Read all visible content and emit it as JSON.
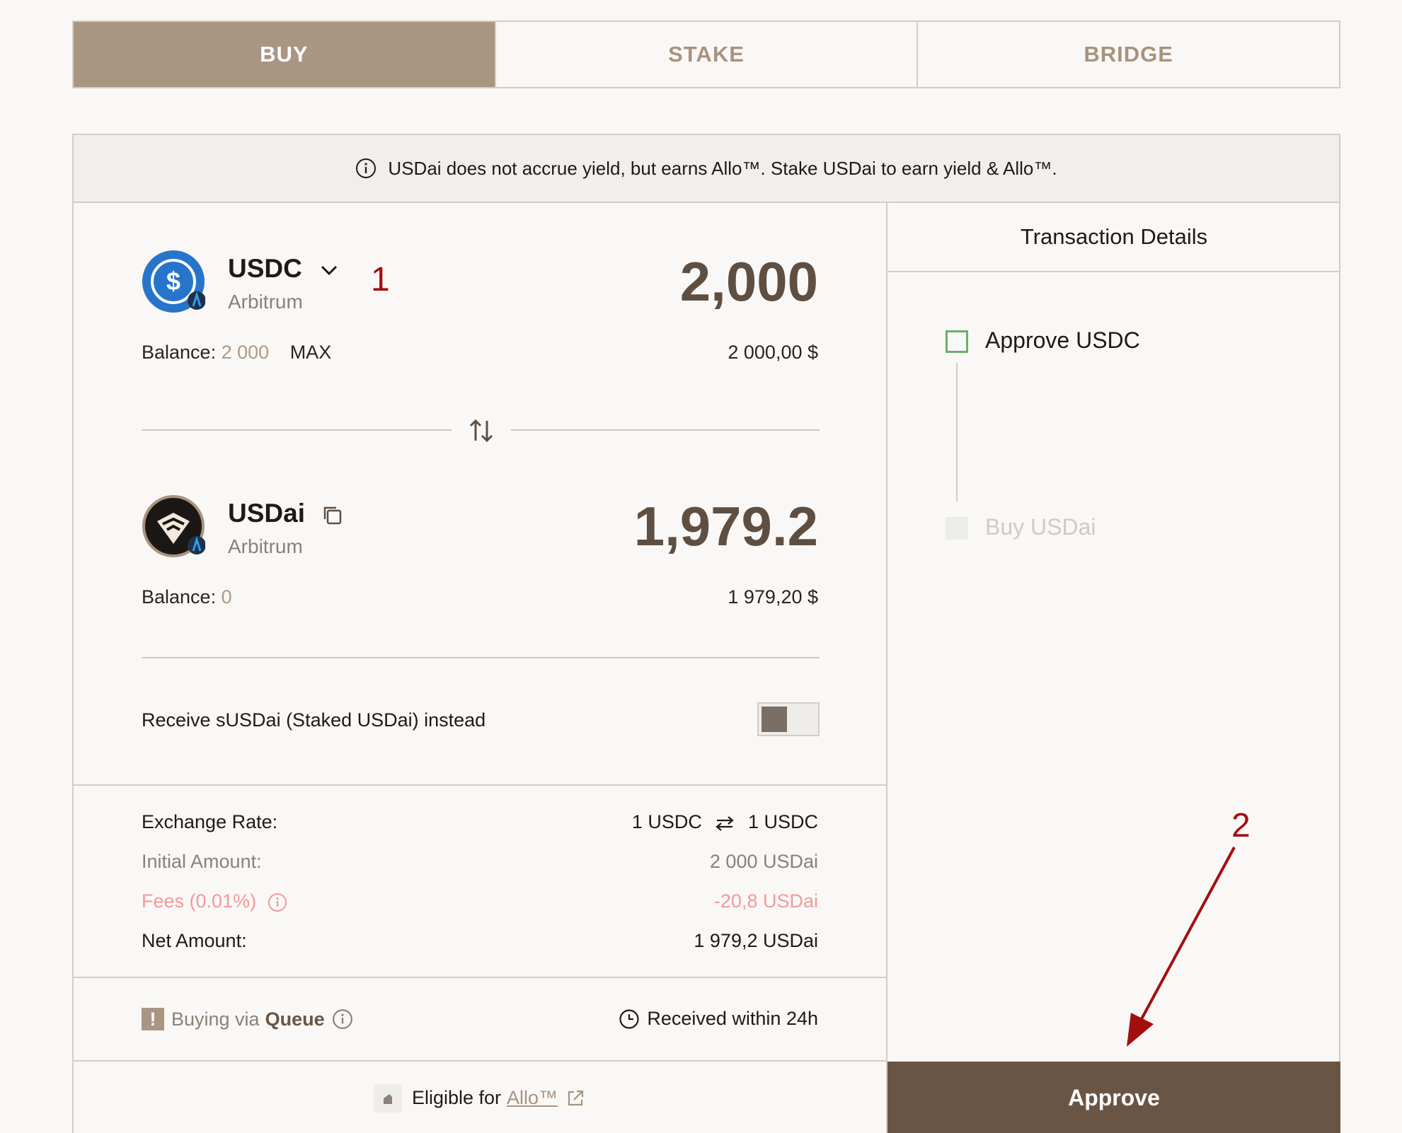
{
  "tabs": [
    {
      "label": "BUY",
      "active": true
    },
    {
      "label": "STAKE",
      "active": false
    },
    {
      "label": "BRIDGE",
      "active": false
    }
  ],
  "notice": "USDai does not accrue yield, but earns Allo™. Stake USDai to earn yield & Allo™.",
  "from": {
    "token": "USDC",
    "network": "Arbitrum",
    "amount": "2,000",
    "balance_label": "Balance:",
    "balance_value": "2 000",
    "max_label": "MAX",
    "usd_value": "2 000,00 $"
  },
  "to": {
    "token": "USDai",
    "network": "Arbitrum",
    "amount": "1,979.2",
    "balance_label": "Balance:",
    "balance_value": "0",
    "usd_value": "1 979,20 $"
  },
  "receive_toggle_label": "Receive sUSDai (Staked USDai) instead",
  "summary": {
    "exchange_rate_label": "Exchange Rate:",
    "exchange_rate_left": "1 USDC",
    "exchange_rate_right": "1 USDC",
    "initial_label": "Initial Amount:",
    "initial_value": "2 000 USDai",
    "fees_label": "Fees (0.01%)",
    "fees_value": "-20,8 USDai",
    "net_label": "Net Amount:",
    "net_value": "1 979,2 USDai"
  },
  "queue": {
    "prefix": "Buying via",
    "strong": "Queue",
    "received": "Received within 24h"
  },
  "eligible": {
    "prefix": "Eligible for",
    "link": "Allo™"
  },
  "details": {
    "title": "Transaction Details",
    "step1": "Approve USDC",
    "step2": "Buy USDai"
  },
  "approve_button": "Approve",
  "annotations": {
    "one": "1",
    "two": "2"
  },
  "colors": {
    "accent": "#aa9583",
    "button": "#6a5545",
    "fees": "#f29a9a",
    "annotation": "#a30f0f",
    "step_active": "#6ab06a"
  }
}
